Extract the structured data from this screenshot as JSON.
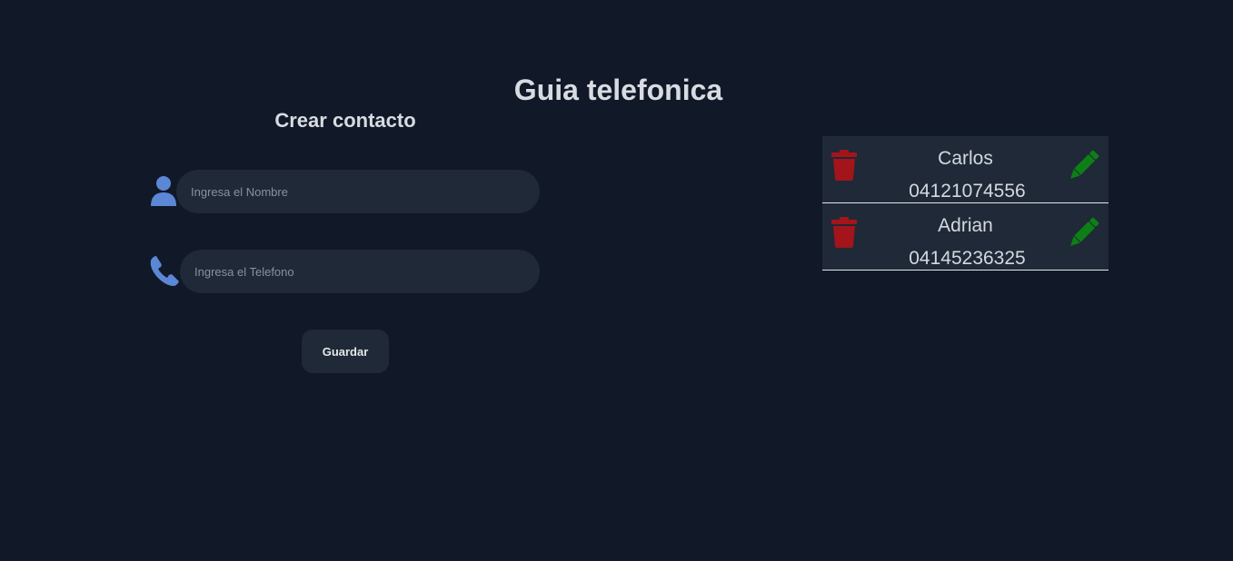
{
  "header": {
    "title": "Guia telefonica"
  },
  "form": {
    "title": "Crear contacto",
    "name_field": {
      "placeholder": "Ingresa el Nombre",
      "value": "",
      "icon": "user-icon"
    },
    "phone_field": {
      "placeholder": "Ingresa el Telefono",
      "value": "",
      "icon": "phone-icon"
    },
    "save_label": "Guardar"
  },
  "contacts": [
    {
      "name": "Carlos",
      "phone": "04121074556"
    },
    {
      "name": "Adrian",
      "phone": "04145236325"
    }
  ],
  "icons": {
    "delete": "trash-icon",
    "edit": "pencil-icon"
  },
  "colors": {
    "background": "#111827",
    "surface": "#1f2937",
    "text": "#d4d8e0",
    "icon_accent": "#5b87d6",
    "delete": "#a3141b",
    "edit": "#0e7f16"
  }
}
